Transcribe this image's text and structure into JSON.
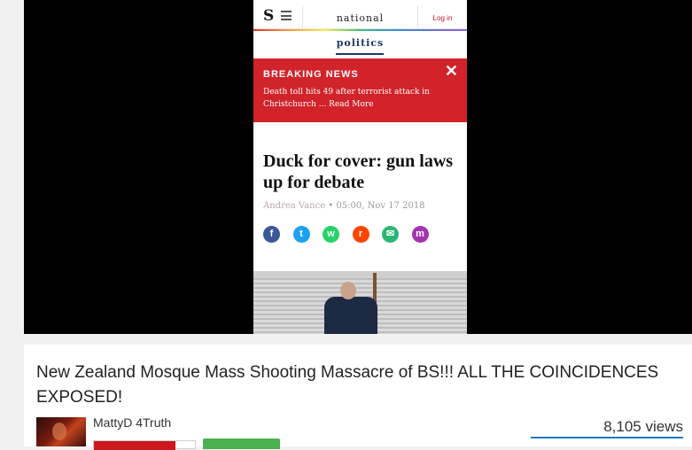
{
  "video_frame": {
    "masthead": {
      "logo_letter": "S",
      "section": "national",
      "login": "Log in"
    },
    "subsection": "politics",
    "breaking": {
      "label": "BREAKING NEWS",
      "text": "Death toll hits 49 after terrorist attack in Christchurch ... Read More",
      "close_glyph": "✕"
    },
    "article": {
      "headline": "Duck for cover: gun laws up for debate",
      "author": "Andrea Vance",
      "bullet": "•",
      "timestamp": "05:00, Nov 17 2018"
    },
    "share_icons": [
      {
        "name": "facebook-icon",
        "glyph": "f",
        "color": "#3b5998"
      },
      {
        "name": "twitter-icon",
        "glyph": "t",
        "color": "#1da1f2"
      },
      {
        "name": "whatsapp-icon",
        "glyph": "w",
        "color": "#25d366"
      },
      {
        "name": "reddit-icon",
        "glyph": "r",
        "color": "#ff4500"
      },
      {
        "name": "email-icon",
        "glyph": "✉",
        "color": "#2bb673"
      },
      {
        "name": "messenger-icon",
        "glyph": "m",
        "color": "#a334b0"
      }
    ]
  },
  "video_info": {
    "title": "New Zealand Mosque Mass Shooting Massacre of BS!!! ALL THE COINCIDENCES EXPOSED!",
    "channel": "MattyD 4Truth",
    "views": "8,105 views"
  },
  "colors": {
    "breaking_red": "#d2232a",
    "subscribe_red": "#cc181e",
    "action_green": "#4caf50",
    "link_blue": "#167ac6"
  }
}
